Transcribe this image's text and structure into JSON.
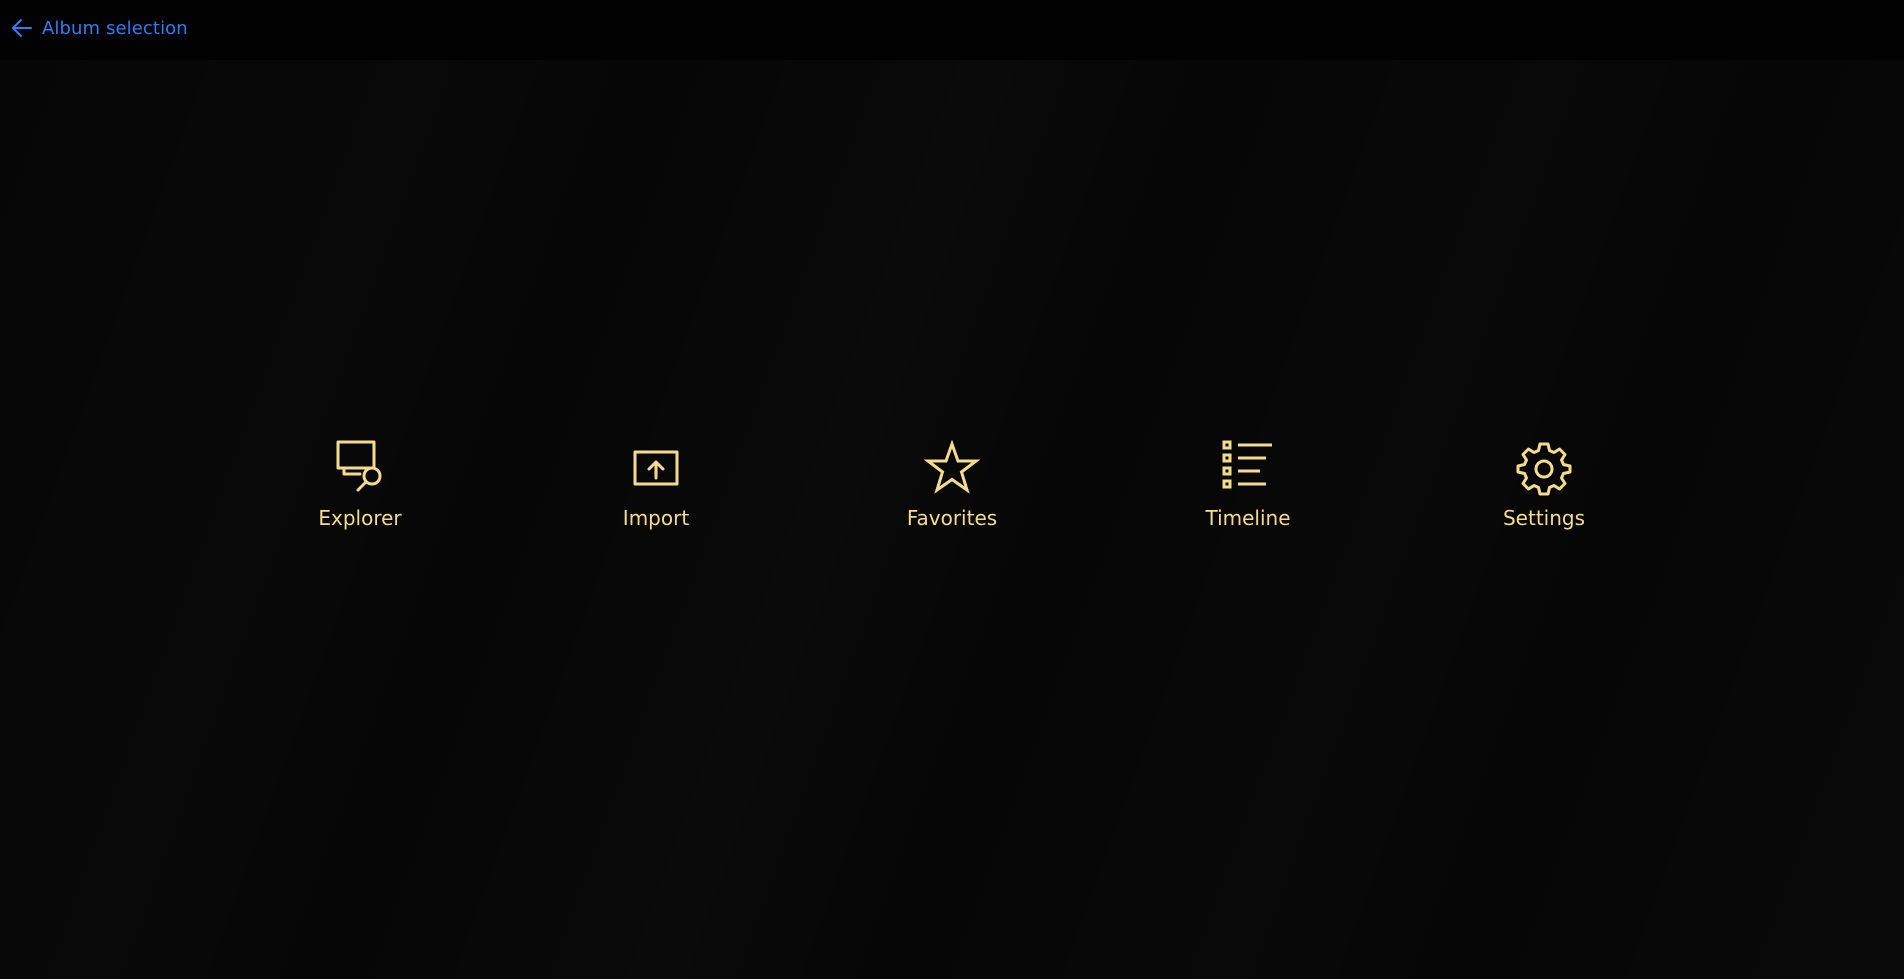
{
  "colors": {
    "accent": "#2f7df6",
    "gold": "#f5dc8c",
    "background": "#060606"
  },
  "header": {
    "back_icon": "arrow-left-icon",
    "back_label": "Album selection"
  },
  "menu": {
    "items": [
      {
        "label": "Explorer",
        "icon": "explorer-icon"
      },
      {
        "label": "Import",
        "icon": "import-icon"
      },
      {
        "label": "Favorites",
        "icon": "star-icon"
      },
      {
        "label": "Timeline",
        "icon": "list-icon"
      },
      {
        "label": "Settings",
        "icon": "gear-icon"
      }
    ]
  }
}
